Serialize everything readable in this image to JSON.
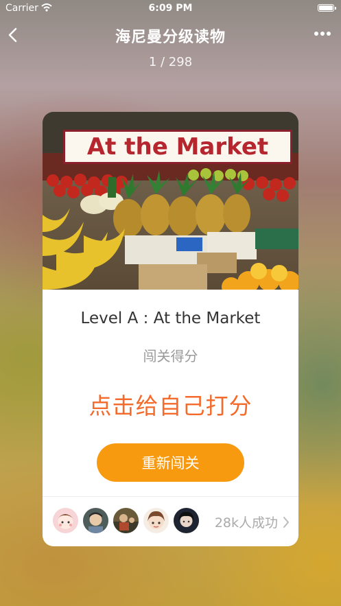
{
  "status_bar": {
    "carrier": "Carrier",
    "time": "6:09 PM"
  },
  "nav": {
    "title": "海尼曼分级读物",
    "page_indicator": "1 / 298",
    "back_icon": "chevron-left-icon",
    "more_icon": "more-horizontal-icon"
  },
  "card": {
    "cover_title": "At the Market",
    "title": "Level A : At the Market",
    "score_label": "闯关得分",
    "rate_prompt": "点击给自己打分",
    "retry_button": "重新闯关",
    "success_count": "28k人成功"
  },
  "colors": {
    "accent_orange": "#f89a0f",
    "prompt_orange": "#f36a2b",
    "cover_title_red": "#b5262f"
  }
}
